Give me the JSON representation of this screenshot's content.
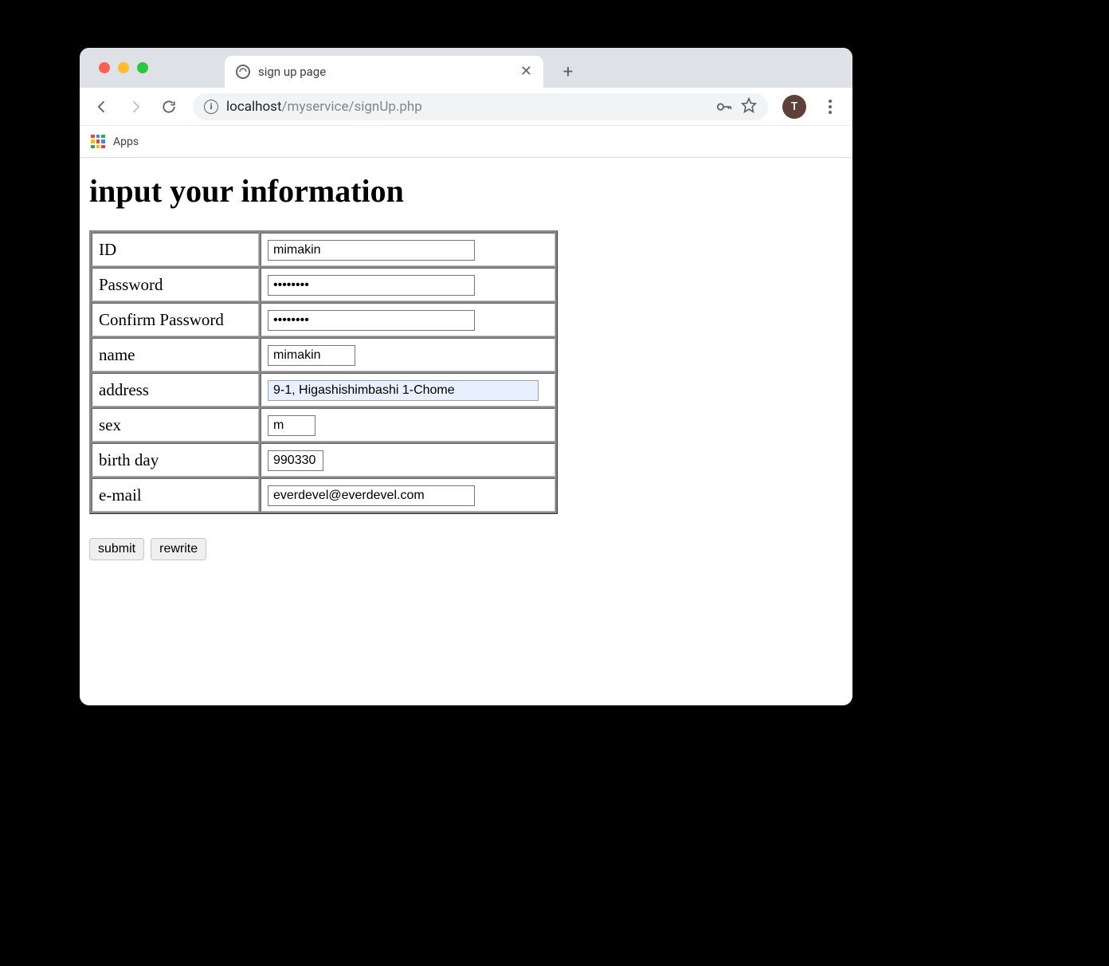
{
  "browser": {
    "tab_title": "sign up page",
    "url_host": "localhost",
    "url_path": "/myservice/signUp.php",
    "bookmarks_apps_label": "Apps",
    "avatar_initial": "T"
  },
  "page": {
    "heading": "input your information",
    "fields": {
      "id": {
        "label": "ID",
        "value": "mimakin"
      },
      "password": {
        "label": "Password",
        "value": "••••••••"
      },
      "confirm_password": {
        "label": "Confirm Password",
        "value": "••••••••"
      },
      "name": {
        "label": "name",
        "value": "mimakin"
      },
      "address": {
        "label": "address",
        "value": "9-1, Higashishimbashi 1-Chome"
      },
      "sex": {
        "label": "sex",
        "value": "m"
      },
      "birth_day": {
        "label": "birth day",
        "value": "990330"
      },
      "email": {
        "label": "e-mail",
        "value": "everdevel@everdevel.com"
      }
    },
    "buttons": {
      "submit": "submit",
      "rewrite": "rewrite"
    }
  }
}
